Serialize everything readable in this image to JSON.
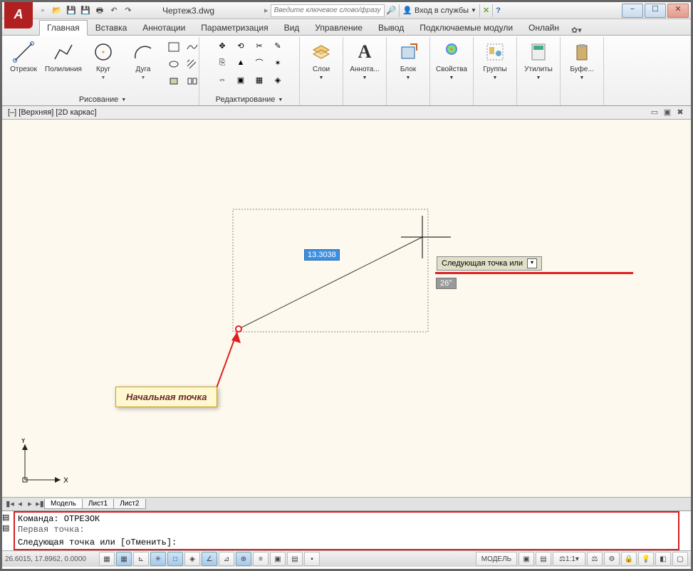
{
  "app": {
    "title": "Чертеж3.dwg"
  },
  "titlebar": {
    "search_placeholder": "Введите ключевое слово/фразу",
    "login_label": "Вход в службы"
  },
  "tabs": [
    {
      "label": "Главная",
      "active": true
    },
    {
      "label": "Вставка"
    },
    {
      "label": "Аннотации"
    },
    {
      "label": "Параметризация"
    },
    {
      "label": "Вид"
    },
    {
      "label": "Управление"
    },
    {
      "label": "Вывод"
    },
    {
      "label": "Подключаемые модули"
    },
    {
      "label": "Онлайн"
    }
  ],
  "ribbon": {
    "draw_panel_label": "Рисование",
    "edit_panel_label": "Редактирование",
    "big_buttons": [
      {
        "label": "Отрезок"
      },
      {
        "label": "Полилиния"
      },
      {
        "label": "Круг"
      },
      {
        "label": "Дуга"
      }
    ],
    "right_panels": [
      {
        "label": "Слои"
      },
      {
        "label": "Аннота..."
      },
      {
        "label": "Блок"
      },
      {
        "label": "Свойства"
      },
      {
        "label": "Группы"
      },
      {
        "label": "Утилиты"
      },
      {
        "label": "Буфе..."
      }
    ]
  },
  "viewport": {
    "label": "[–] [Верхняя] [2D каркас]"
  },
  "canvas": {
    "dim_value": "13.3038",
    "angle_value": "26°",
    "prompt": "Следующая точка или",
    "annotation": "Начальная точка",
    "ucs_x": "X",
    "ucs_y": "Y"
  },
  "model_tabs": [
    {
      "label": "Модель",
      "active": true
    },
    {
      "label": "Лист1"
    },
    {
      "label": "Лист2"
    }
  ],
  "cmd": {
    "line1": "Команда: ОТРЕЗОК",
    "line2": "Первая точка:",
    "line3": "Следующая точка или [оТменить]:"
  },
  "status": {
    "coords": "26.6015, 17.8962, 0.0000",
    "model": "МОДЕЛЬ",
    "scale": "1:1"
  }
}
